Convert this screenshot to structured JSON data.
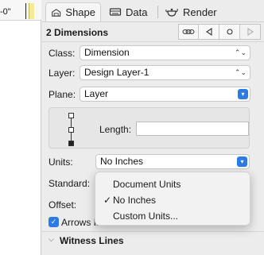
{
  "ruler": {
    "text": "-0\""
  },
  "tabs": [
    {
      "label": "Shape",
      "icon": "shape-icon"
    },
    {
      "label": "Data",
      "icon": "data-icon"
    },
    {
      "label": "Render",
      "icon": "teapot-icon"
    }
  ],
  "section": {
    "title": "2 Dimensions",
    "buttons": [
      "chain-link-icon",
      "triangle-left-icon",
      "circle-icon",
      "triangle-right-icon"
    ]
  },
  "fields": {
    "class_label": "Class:",
    "class_value": "Dimension",
    "layer_label": "Layer:",
    "layer_value": "Design Layer-1",
    "plane_label": "Plane:",
    "plane_value": "Layer",
    "length_label": "Length:",
    "length_value": "",
    "units_label": "Units:",
    "units_value": "No Inches",
    "standard_label": "Standard:",
    "offset_label": "Offset:",
    "arrows_label": "Arrows In"
  },
  "units_menu": {
    "items": [
      {
        "label": "Document Units",
        "checked": false
      },
      {
        "label": "No Inches",
        "checked": true
      },
      {
        "label": "Custom Units...",
        "checked": false
      }
    ]
  },
  "witness": {
    "title": "Witness Lines"
  },
  "colors": {
    "accent": "#2c7be5",
    "ruler_mark": "#f3ea9a"
  }
}
